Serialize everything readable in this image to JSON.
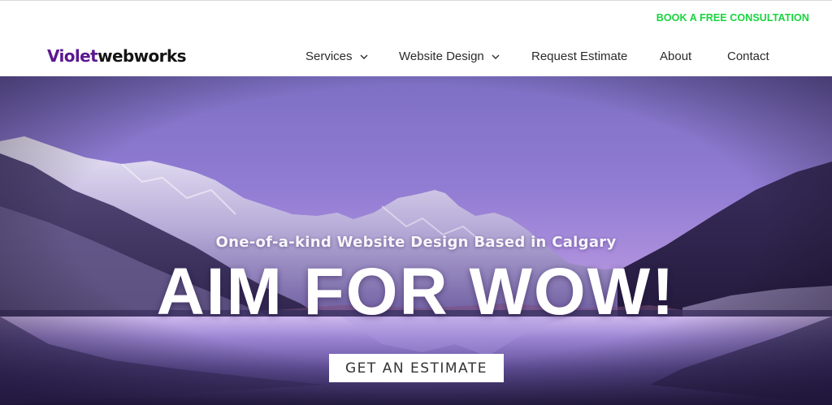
{
  "topbar": {
    "consult_label": "BOOK A FREE CONSULTATION"
  },
  "logo": {
    "part1": "Violet",
    "part2": "webworks"
  },
  "nav": [
    {
      "label": "Services",
      "has_dropdown": true
    },
    {
      "label": "Website Design",
      "has_dropdown": true
    },
    {
      "label": "Request Estimate",
      "has_dropdown": false
    },
    {
      "label": "About",
      "has_dropdown": false
    },
    {
      "label": "Contact",
      "has_dropdown": false
    }
  ],
  "icons": {
    "dropdown": "chevron-down-icon"
  },
  "hero": {
    "subtitle": "One-of-a-kind Website Design Based in Calgary",
    "title": "AIM FOR WOW!",
    "cta_label": "GET AN ESTIMATE"
  },
  "colors": {
    "accent_green": "#19d43e",
    "brand_violet": "#5b1891",
    "sky_purple": "#8e78cf"
  }
}
